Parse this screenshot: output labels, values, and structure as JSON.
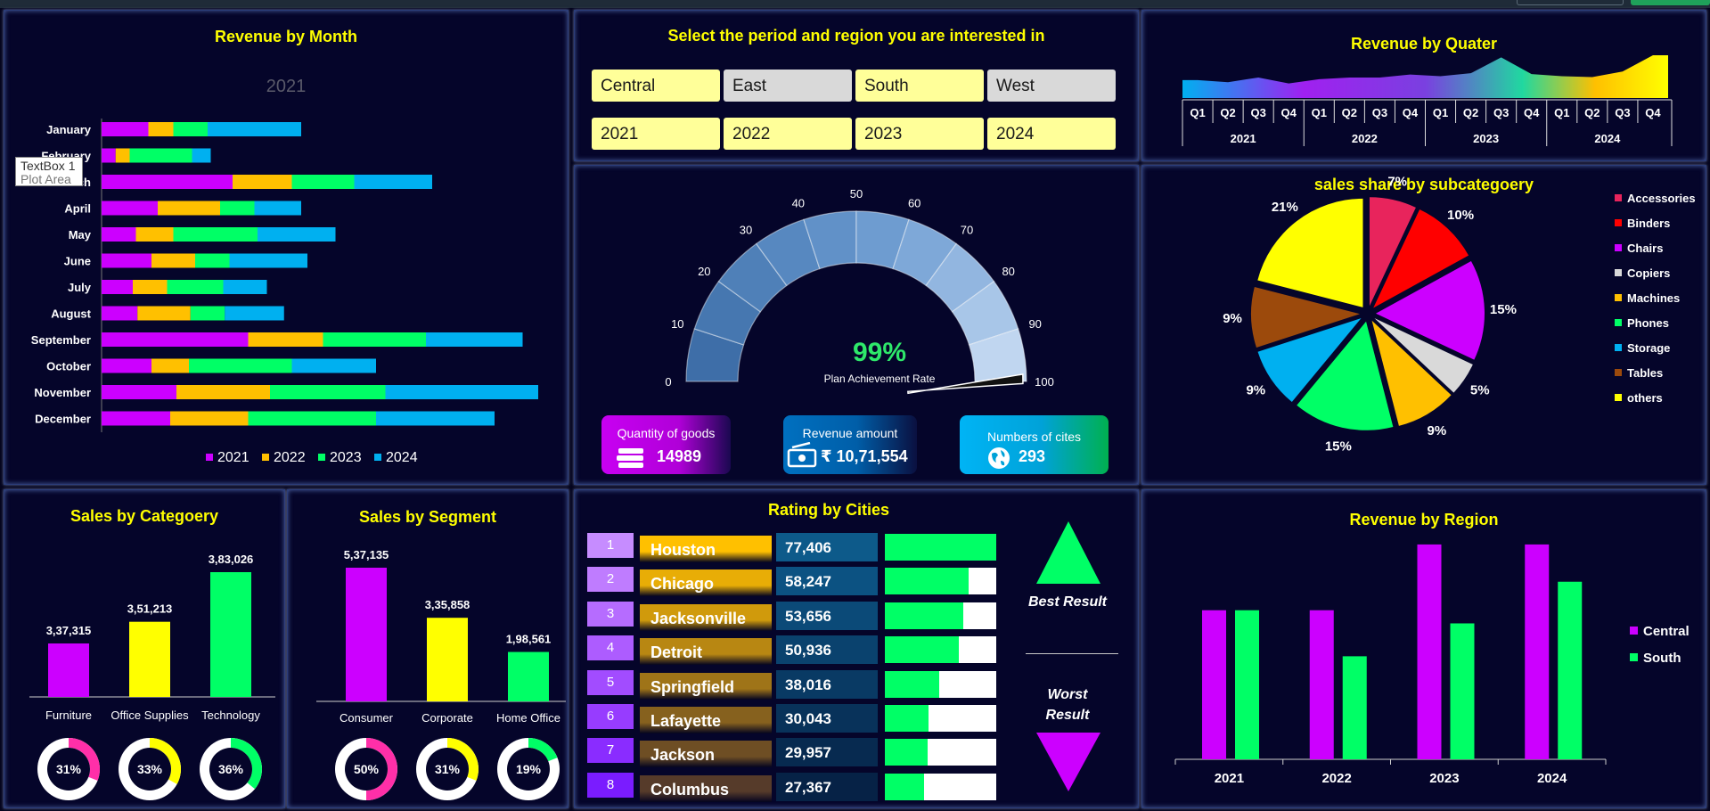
{
  "overlay": {
    "textbox_label": "TextBox 1",
    "plot_area_label": "Plot Area"
  },
  "revenue_by_month": {
    "title": "Revenue by Month",
    "year_label": "2021",
    "colors": [
      "#cc00ff",
      "#ffc000",
      "#00ff66",
      "#00b0f0"
    ]
  },
  "slicers": {
    "title": "Select the period and region you are interested in",
    "regions": [
      {
        "label": "Central",
        "selected": true
      },
      {
        "label": "East",
        "selected": false
      },
      {
        "label": "South",
        "selected": true
      },
      {
        "label": "West",
        "selected": false
      }
    ],
    "years": [
      {
        "label": "2021",
        "selected": true
      },
      {
        "label": "2022",
        "selected": true
      },
      {
        "label": "2023",
        "selected": true
      },
      {
        "label": "2024",
        "selected": true
      }
    ]
  },
  "revenue_by_quarter": {
    "title": "Revenue by Quater"
  },
  "gauge": {
    "value_label": "99%",
    "caption": "Plan Achievement Rate"
  },
  "kpis": {
    "quantity": {
      "label": "Quantity of goods",
      "value": "14989"
    },
    "revenue": {
      "label": "Revenue amount",
      "value": "₹ 10,71,554"
    },
    "cities": {
      "label": "Numbers of cites",
      "value": "293"
    }
  },
  "subcategory": {
    "title": "sales share by subcategoery",
    "legend": [
      {
        "name": "Accessories",
        "color": "#e8245c"
      },
      {
        "name": "Binders",
        "color": "#ff0000"
      },
      {
        "name": "Chairs",
        "color": "#cc00ff"
      },
      {
        "name": "Copiers",
        "color": "#d9d9d9"
      },
      {
        "name": "Machines",
        "color": "#ffc000"
      },
      {
        "name": "Phones",
        "color": "#00ff66"
      },
      {
        "name": "Storage",
        "color": "#00b0f0"
      },
      {
        "name": "Tables",
        "color": "#9c4a0c"
      },
      {
        "name": "others",
        "color": "#ffff00"
      }
    ]
  },
  "category": {
    "title": "Sales by Categoery",
    "donuts": [
      "31%",
      "33%",
      "36%"
    ]
  },
  "segment": {
    "title": "Sales by Segment",
    "donuts": [
      "50%",
      "31%",
      "19%"
    ]
  },
  "rating": {
    "title": "Rating by Cities",
    "best_label": "Best Result",
    "worst_label": "Worst Result",
    "rows": [
      {
        "rank": "1",
        "city": "Houston",
        "value": "77,406",
        "fill": 1.0
      },
      {
        "rank": "2",
        "city": "Chicago",
        "value": "58,247",
        "fill": 0.75
      },
      {
        "rank": "3",
        "city": "Jacksonville",
        "value": "53,656",
        "fill": 0.7
      },
      {
        "rank": "4",
        "city": "Detroit",
        "value": "50,936",
        "fill": 0.66
      },
      {
        "rank": "5",
        "city": "Springfield",
        "value": "38,016",
        "fill": 0.49
      },
      {
        "rank": "6",
        "city": "Lafayette",
        "value": "30,043",
        "fill": 0.39
      },
      {
        "rank": "7",
        "city": "Jackson",
        "value": "29,957",
        "fill": 0.38
      },
      {
        "rank": "8",
        "city": "Columbus",
        "value": "27,367",
        "fill": 0.35
      }
    ]
  },
  "revenue_by_region": {
    "title": "Revenue by Region"
  },
  "chart_data": [
    {
      "type": "bar",
      "orientation": "horizontal",
      "stacked": true,
      "title": "Revenue by Month",
      "categories": [
        "January",
        "February",
        "March",
        "April",
        "May",
        "June",
        "July",
        "August",
        "September",
        "October",
        "November",
        "December"
      ],
      "series": [
        {
          "name": "2021",
          "values": [
            15000,
            4500,
            42000,
            18000,
            11000,
            16000,
            10000,
            11500,
            47000,
            16000,
            24000,
            22000
          ]
        },
        {
          "name": "2022",
          "values": [
            8000,
            4500,
            19000,
            20000,
            12000,
            14000,
            11000,
            17000,
            24000,
            12000,
            30000,
            25000
          ]
        },
        {
          "name": "2023",
          "values": [
            11000,
            20000,
            20000,
            11000,
            27000,
            11000,
            18000,
            11000,
            33000,
            33000,
            37000,
            41000
          ]
        },
        {
          "name": "2024",
          "values": [
            30000,
            6000,
            25000,
            15000,
            25000,
            25000,
            14000,
            19000,
            31000,
            27000,
            49000,
            38000
          ]
        }
      ],
      "xlim": [
        0,
        150000
      ],
      "legend": "bottom"
    },
    {
      "type": "area",
      "title": "Revenue by Quater",
      "x": [
        {
          "year": "2021",
          "quarters": [
            "Q1",
            "Q2",
            "Q3",
            "Q4"
          ]
        },
        {
          "year": "2022",
          "quarters": [
            "Q1",
            "Q2",
            "Q3",
            "Q4"
          ]
        },
        {
          "year": "2023",
          "quarters": [
            "Q1",
            "Q2",
            "Q3",
            "Q4"
          ]
        },
        {
          "year": "2024",
          "quarters": [
            "Q1",
            "Q2",
            "Q3",
            "Q4"
          ]
        }
      ],
      "values": [
        42,
        37,
        48,
        34,
        44,
        48,
        48,
        55,
        51,
        58,
        95,
        56,
        51,
        49,
        62,
        100
      ],
      "ylim": [
        0,
        100
      ]
    },
    {
      "type": "gauge",
      "value": 99,
      "ticks": [
        0,
        10,
        20,
        30,
        40,
        50,
        60,
        70,
        80,
        90,
        100
      ],
      "range": [
        0,
        100
      ]
    },
    {
      "type": "pie",
      "title": "sales share by subcategoery",
      "labels": [
        "Accessories",
        "Binders",
        "Chairs",
        "Copiers",
        "Machines",
        "Phones",
        "Storage",
        "Tables",
        "others"
      ],
      "values": [
        7,
        10,
        15,
        5,
        9,
        15,
        9,
        9,
        21
      ],
      "data_labels": [
        "7%",
        "10%",
        "15%",
        "5%",
        "9%",
        "15%",
        "9%",
        "9%",
        "21%"
      ],
      "legend": "right"
    },
    {
      "type": "bar",
      "title": "Sales by Categoery",
      "categories": [
        "Furniture",
        "Office Supplies",
        "Technology"
      ],
      "values": [
        337315,
        351213,
        383026
      ],
      "data_labels": [
        "3,37,315",
        "3,51,213",
        "3,83,026"
      ],
      "colors": [
        "#cc00ff",
        "#ffff00",
        "#00ff66"
      ],
      "ylim": [
        200000,
        400000
      ]
    },
    {
      "type": "bar",
      "title": "Sales by Segment",
      "categories": [
        "Consumer",
        "Corporate",
        "Home Office"
      ],
      "values": [
        537135,
        335858,
        198561
      ],
      "data_labels": [
        "5,37,135",
        "3,35,858",
        "1,98,561"
      ],
      "colors": [
        "#cc00ff",
        "#ffff00",
        "#00ff66"
      ],
      "ylim": [
        0,
        560000
      ]
    },
    {
      "type": "bar",
      "title": "Revenue by Region",
      "categories": [
        "2021",
        "2022",
        "2023",
        "2024"
      ],
      "series": [
        {
          "name": "Central",
          "values": [
            68,
            68,
            98,
            98
          ],
          "color": "#cc00ff"
        },
        {
          "name": "South",
          "values": [
            68,
            47,
            62,
            81
          ],
          "color": "#00ff66"
        }
      ],
      "ylim": [
        0,
        100
      ],
      "legend": "right"
    }
  ]
}
